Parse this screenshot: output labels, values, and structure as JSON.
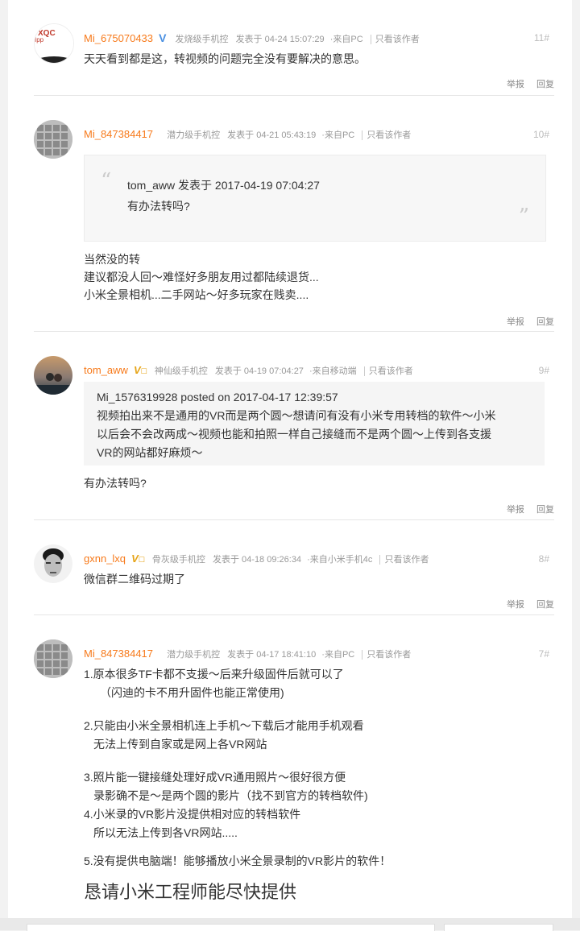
{
  "posts": [
    {
      "username": "Mi_675070433",
      "level": "发烧级手机控",
      "posted": "发表于 04-24 15:07:29",
      "source": "来自PC",
      "only_author": "只看该作者",
      "floor": "11#",
      "body": "天天看到都是这，转视频的问题完全没有要解决的意思。",
      "report": "举报",
      "reply": "回复"
    },
    {
      "username": "Mi_847384417",
      "level": "潜力级手机控",
      "posted": "发表于 04-21 05:43:19",
      "source": "来自PC",
      "only_author": "只看该作者",
      "floor": "10#",
      "quote_header": "tom_aww 发表于 2017-04-19 07:04:27",
      "quote_body": "有办法转吗?",
      "lines": [
        "当然没的转",
        "建议都没人回～难怪好多朋友用过都陆续退货...",
        "小米全景相机...二手网站～好多玩家在贱卖...."
      ],
      "report": "举报",
      "reply": "回复"
    },
    {
      "username": "tom_aww",
      "level": "神仙级手机控",
      "posted": "发表于 04-19 07:04:27",
      "source": "来自移动端",
      "only_author": "只看该作者",
      "floor": "9#",
      "quote_header": "Mi_1576319928 posted on 2017-04-17 12:39:57",
      "quote_lines": [
        "视频拍出来不是通用的VR而是两个圆～想请问有没有小米专用转档的软件～小米",
        "以后会不会改两成～视频也能和拍照一样自己接缝而不是两个圆～上传到各支援",
        "VR的网站都好麻烦～"
      ],
      "body": "有办法转吗?",
      "report": "举报",
      "reply": "回复"
    },
    {
      "username": "gxnn_lxq",
      "level": "骨灰级手机控",
      "posted": "发表于 04-18 09:26:34",
      "source": "来自小米手机4c",
      "only_author": "只看该作者",
      "floor": "8#",
      "body": "微信群二维码过期了",
      "report": "举报",
      "reply": "回复"
    },
    {
      "username": "Mi_847384417",
      "level": "潜力级手机控",
      "posted": "发表于 04-17 18:41:10",
      "source": "来自PC",
      "only_author": "只看该作者",
      "floor": "7#",
      "lines": [
        "1.原本很多TF卡都不支援～后来升级固件后就可以了",
        "（闪迪的卡不用升固件也能正常使用)",
        "2.只能由小米全景相机连上手机～下载后才能用手机观看",
        "无法上传到自家或是网上各VR网站",
        "3.照片能一键接缝处理好成VR通用照片～很好很方便",
        "录影确不是～是两个圆的影片（找不到官方的转档软件)",
        "4.小米录的VR影片没提供相对应的转档软件",
        "所以无法上传到各VR网站.....",
        "5.没有提供电脑端！能够播放小米全景录制的VR影片的软件！"
      ],
      "headline": "恳请小米工程师能尽快提供"
    }
  ]
}
